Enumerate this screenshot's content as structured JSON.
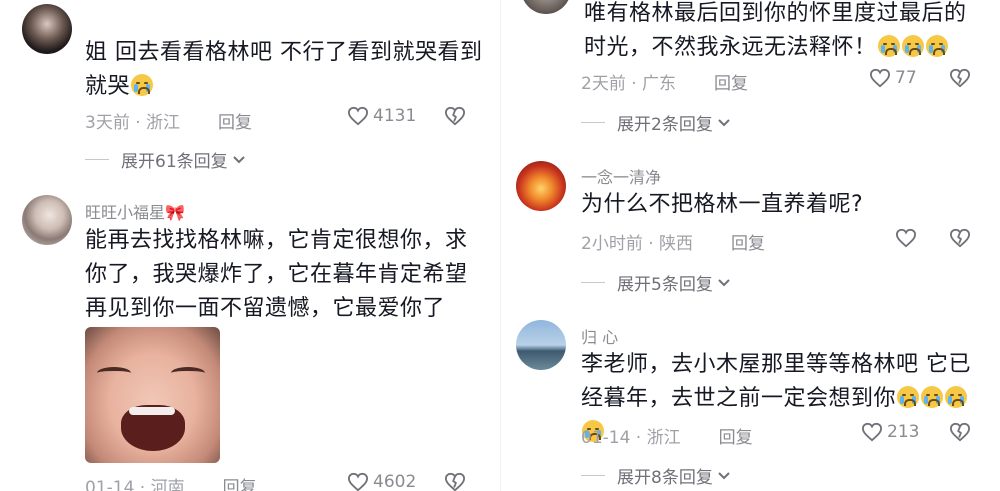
{
  "left": {
    "c1": {
      "text": "姐 回去看看格林吧 不行了看到就哭看到就哭",
      "location": "3天前 · 浙江",
      "reply": "回复",
      "likes": "4131",
      "expand": "展开61条回复"
    },
    "c2": {
      "username": "旺旺小福星🎀",
      "text": "能再去找找格林嘛，它肯定很想你，求你了，我哭爆炸了，它在暮年肯定希望再见到你一面不留遗憾，它最爱你了",
      "location": "01-14 · 河南",
      "reply": "回复",
      "likes": "4602"
    }
  },
  "right": {
    "c1": {
      "text": "唯有格林最后回到你的怀里度过最后的时光，不然我永远无法释怀！",
      "location": "2天前 · 广东",
      "reply": "回复",
      "likes": "77",
      "expand": "展开2条回复"
    },
    "c2": {
      "username": "一念一清净",
      "text": "为什么不把格林一直养着呢?",
      "location": "2小时前 · 陕西",
      "reply": "回复",
      "expand": "展开5条回复"
    },
    "c3": {
      "username": "归 心",
      "text": "李老师，去小木屋那里等等格林吧 它已经暮年，去世之前一定会想到你",
      "location": "01-14 · 浙江",
      "reply": "回复",
      "likes": "213",
      "expand": "展开8条回复"
    }
  },
  "icons": {
    "like": "heart-outline-icon",
    "dislike": "broken-heart-icon",
    "expand": "chevron-down-icon",
    "emoji": "crying-face-emoji"
  }
}
